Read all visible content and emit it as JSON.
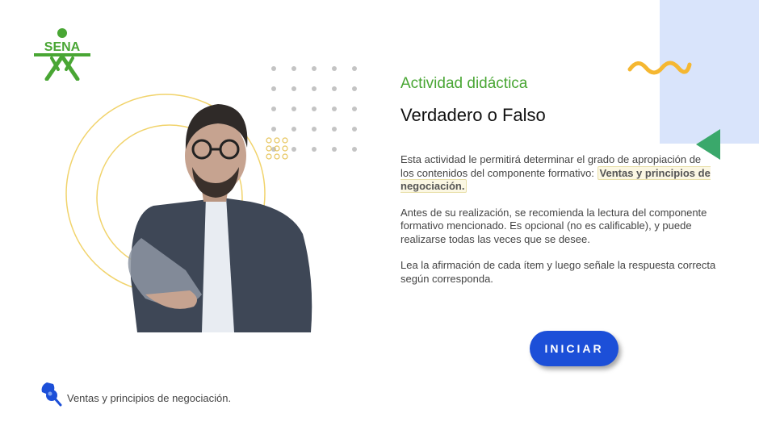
{
  "brand": {
    "logo_text": "SENA",
    "color": "#49a634"
  },
  "activity": {
    "label": "Actividad didáctica",
    "title": "Verdadero o Falso",
    "paragraph1_pre": "Esta actividad le permitirá determinar el grado de apropiación de los contenidos del componente formativo: ",
    "paragraph1_highlight": "Ventas y principios de negociación.",
    "paragraph2": "Antes de su realización, se recomienda la lectura del componente formativo mencionado. Es opcional (no es calificable), y puede realizarse todas las veces que se desee.",
    "paragraph3": "Lea la afirmación de cada ítem y luego señale la respuesta correcta según corresponda."
  },
  "start_button": {
    "label": "INICIAR",
    "color": "#1c4fd8"
  },
  "footer": {
    "text": "Ventas y principios de negociación.",
    "icon": "pushpin-icon"
  },
  "colors": {
    "panel": "#d9e4fb",
    "accent_yellow": "#f5b731",
    "accent_green": "#3aa86b"
  }
}
